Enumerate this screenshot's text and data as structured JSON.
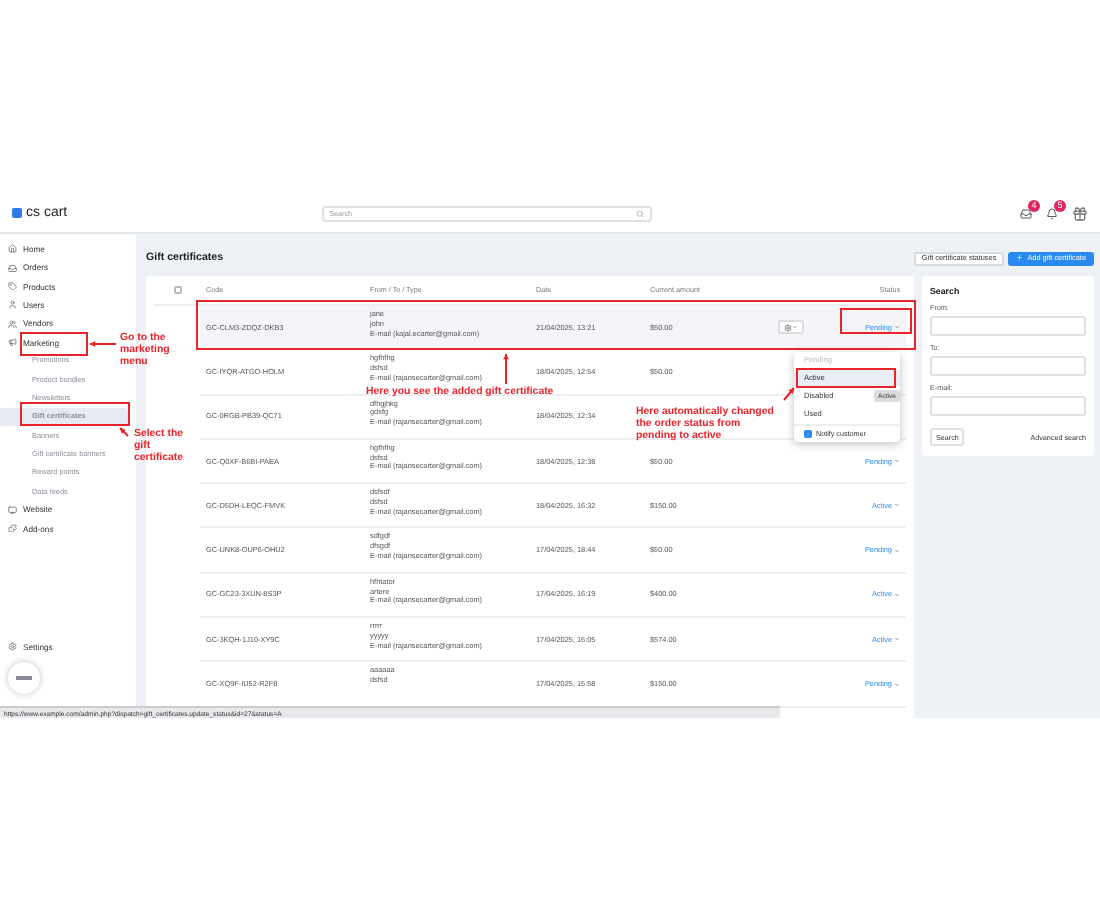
{
  "header": {
    "logo": "cs cart",
    "search_placeholder": "Search",
    "notification_badges": [
      "4",
      "5"
    ]
  },
  "sidebar": {
    "items": [
      {
        "label": "Home",
        "selected": false
      },
      {
        "label": "Orders",
        "selected": false
      },
      {
        "label": "Products",
        "selected": false
      },
      {
        "label": "Users",
        "selected": false
      },
      {
        "label": "Vendors",
        "selected": false
      },
      {
        "label": "Marketing",
        "selected": false,
        "children": [
          {
            "label": "Promotions",
            "selected": false
          },
          {
            "label": "Product bundles",
            "selected": false
          },
          {
            "label": "Newsletters",
            "selected": false
          },
          {
            "label": "Gift certificates",
            "selected": true
          },
          {
            "label": "Banners",
            "selected": false
          },
          {
            "label": "Gift certificate banners",
            "selected": false
          },
          {
            "label": "Reward points",
            "selected": false
          },
          {
            "label": "Data feeds",
            "selected": false
          }
        ]
      },
      {
        "label": "Website",
        "selected": false
      },
      {
        "label": "Add-ons",
        "selected": false
      }
    ],
    "settings": "Settings"
  },
  "page": {
    "title": "Gift certificates",
    "buttons": [
      {
        "label": "Gift certificate statuses",
        "kind": "secondary"
      },
      {
        "label": "Add gift certificate",
        "kind": "primary"
      }
    ]
  },
  "table": {
    "select_all": {
      "checked": false
    },
    "columns": [
      "Code",
      "From / To / Type",
      "Date",
      "Current amount",
      "Status"
    ],
    "rows": [
      {
        "code": "GC-CLM3-ZDQZ-DKB3",
        "lines": [
          "jane",
          "john",
          "E-mail (kajal.ecarter@gmail.com)"
        ],
        "date": "21/04/2025, 13:21",
        "amount": "$50.00",
        "status": "Pending",
        "selected": true
      },
      {
        "code": "GC-IYQR-ATGO-HOLM",
        "lines": [
          "hgfhfhg",
          "dsfsd",
          "E-mail (rajansecarter@gmail.com)"
        ],
        "date": "18/04/2025, 12:54",
        "amount": "$50.00",
        "selected": false
      },
      {
        "code": "GC-0RGB-PB39-QC71",
        "lines": [
          "dfhgjhkg",
          "gdsfg",
          "E-mail (rajansecarter@gmail.com)"
        ],
        "date": "18/04/2025, 12:34",
        "selected": false
      },
      {
        "code": "GC-Q0XF-B6BI-PAEA",
        "lines": [
          "hgfhfhg",
          "dsfsd",
          "E-mail (rajansecarter@gmail.com)"
        ],
        "date": "18/04/2025, 12:38",
        "amount": "$50.00",
        "status": "Pending",
        "selected": false
      },
      {
        "code": "GC-D5DH-LEQC-FMVK",
        "lines": [
          "dsfsdf",
          "dsfsd",
          "E-mail (rajansecarter@gmail.com)"
        ],
        "date": "18/04/2025, 16:32",
        "amount": "$150.00",
        "status": "Active",
        "selected": false
      },
      {
        "code": "GC-UNK8-OUP6-OHU2",
        "lines": [
          "sdfgdf",
          "dfsgdf",
          "E-mail (rajansecarter@gmail.com)"
        ],
        "date": "17/04/2025, 18:44",
        "amount": "$50.00",
        "status": "Pending",
        "selected": false
      },
      {
        "code": "GC-GC23-3XUN-8S3P",
        "lines": [
          "hfhtator",
          "artere",
          "E-mail (rajansecarter@gmail.com)"
        ],
        "date": "17/04/2025, 16:19",
        "amount": "$400.00",
        "status": "Active",
        "selected": false
      },
      {
        "code": "GC-3KQH-1J10-XY9C",
        "lines": [
          "rrrrr",
          "yyyyy",
          "E-mail (rajansecarter@gmail.com)"
        ],
        "date": "17/04/2025, 16:05",
        "amount": "$574.00",
        "status": "Active",
        "selected": false
      },
      {
        "code": "GC-XQ9F-IU52-R2F8",
        "lines": [
          "aaaaaa",
          "dsfsd"
        ],
        "date": "17/04/2025, 15:58",
        "amount": "$150.00",
        "status": "Pending",
        "selected": false
      }
    ]
  },
  "status_menu": {
    "items": [
      {
        "label": "Pending",
        "disabled": true,
        "selected": false
      },
      {
        "label": "Active",
        "disabled": false,
        "selected": true
      },
      {
        "label": "Disabled",
        "disabled": false,
        "selected": false
      },
      {
        "label": "Used",
        "disabled": false,
        "selected": false
      }
    ],
    "notify": {
      "label": "Notify customer",
      "checked": true
    },
    "tooltip": "Active"
  },
  "search_panel": {
    "title": "Search",
    "fields": [
      "From:",
      "To:",
      "E-mail:"
    ],
    "button": "Search",
    "link": "Advanced search"
  },
  "status_bar": "https://www.example.com/admin.php?dispatch=gift_certificates.update_status&id=27&status=A",
  "annotations": [
    "Go to the marketing menu",
    "Select the gift certificate",
    "Here you see the added gift certificate",
    "Here automatically changed the order status from pending to active"
  ]
}
